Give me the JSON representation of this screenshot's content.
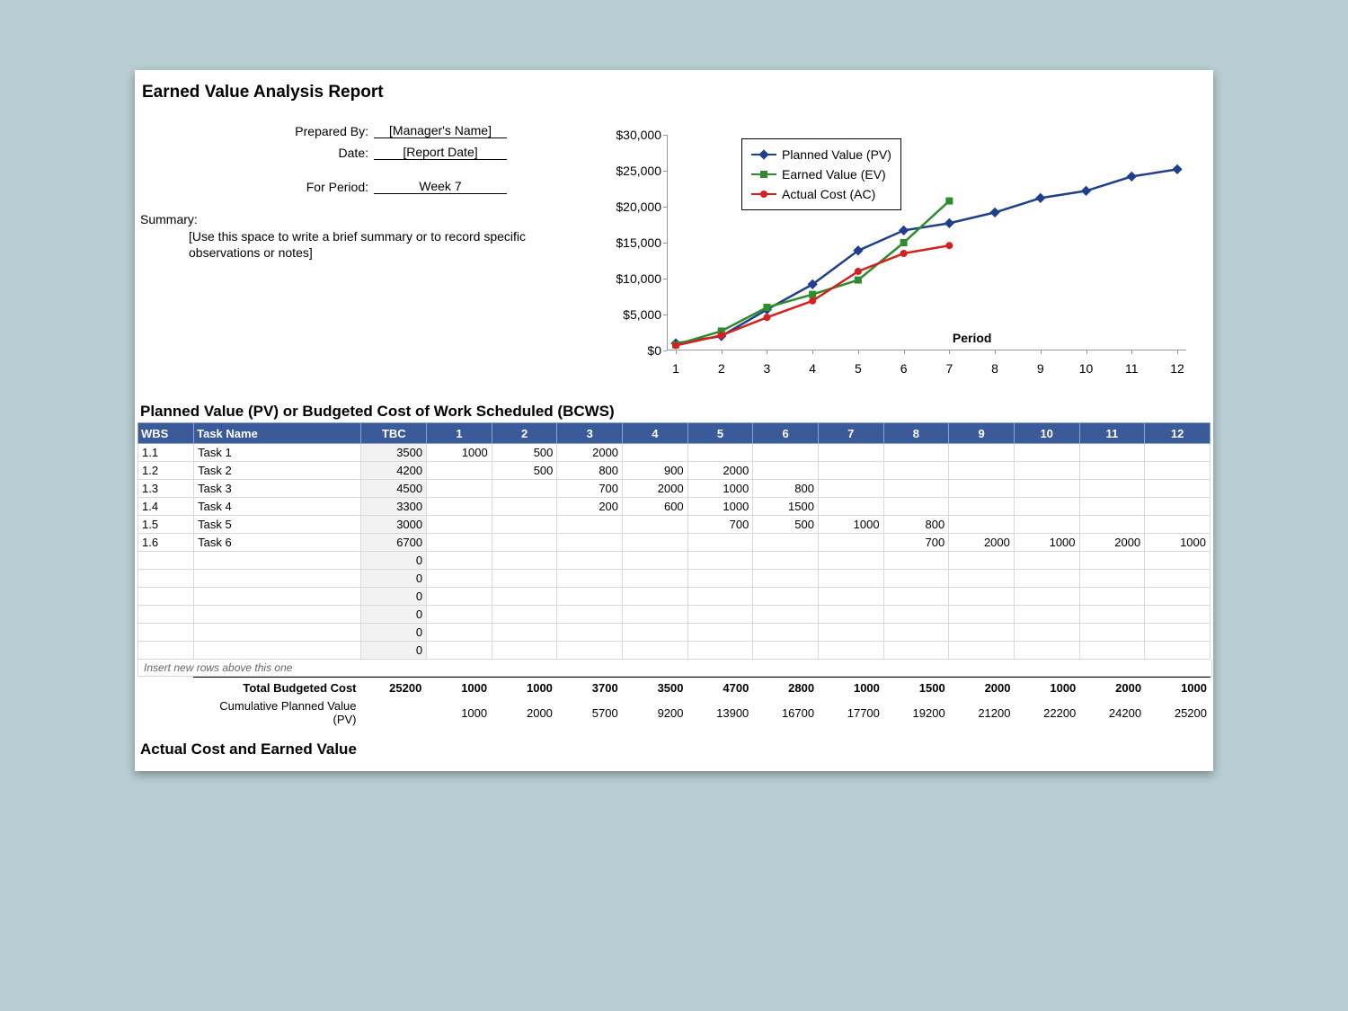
{
  "title": "Earned Value Analysis Report",
  "meta": {
    "prepared_by_label": "Prepared By:",
    "prepared_by_value": "[Manager's Name]",
    "date_label": "Date:",
    "date_value": "[Report Date]",
    "period_label": "For Period:",
    "period_value": "Week 7"
  },
  "summary": {
    "label": "Summary:",
    "text": "[Use this space to write a brief summary or to record specific observations or notes]"
  },
  "chart_data": {
    "type": "line",
    "title": "",
    "xlabel": "Period",
    "ylabel": "",
    "x": [
      1,
      2,
      3,
      4,
      5,
      6,
      7,
      8,
      9,
      10,
      11,
      12
    ],
    "ylim": [
      0,
      30000
    ],
    "yticks": [
      "$0",
      "$5,000",
      "$10,000",
      "$15,000",
      "$20,000",
      "$25,000",
      "$30,000"
    ],
    "series": [
      {
        "name": "Planned Value (PV)",
        "color": "#1f3f8c",
        "marker": "diamond",
        "values": [
          1000,
          2000,
          5700,
          9200,
          13900,
          16700,
          17700,
          19200,
          21200,
          22200,
          24200,
          25200
        ]
      },
      {
        "name": "Earned Value (EV)",
        "color": "#2e8b2e",
        "marker": "square",
        "values": [
          800,
          2700,
          6000,
          7800,
          9800,
          15000,
          20800,
          null,
          null,
          null,
          null,
          null
        ]
      },
      {
        "name": "Actual Cost (AC)",
        "color": "#d62020",
        "marker": "circle",
        "values": [
          700,
          2100,
          4600,
          6900,
          11000,
          13500,
          14600,
          null,
          null,
          null,
          null,
          null
        ]
      }
    ]
  },
  "pv_table": {
    "section_title": "Planned Value (PV) or Budgeted Cost of Work Scheduled (BCWS)",
    "columns": [
      "WBS",
      "Task Name",
      "TBC",
      "1",
      "2",
      "3",
      "4",
      "5",
      "6",
      "7",
      "8",
      "9",
      "10",
      "11",
      "12"
    ],
    "rows": [
      {
        "wbs": "1.1",
        "task": "Task 1",
        "tbc": "3500",
        "p": [
          "1000",
          "500",
          "2000",
          "",
          "",
          "",
          "",
          "",
          "",
          "",
          "",
          ""
        ]
      },
      {
        "wbs": "1.2",
        "task": "Task 2",
        "tbc": "4200",
        "p": [
          "",
          "500",
          "800",
          "900",
          "2000",
          "",
          "",
          "",
          "",
          "",
          "",
          ""
        ]
      },
      {
        "wbs": "1.3",
        "task": "Task 3",
        "tbc": "4500",
        "p": [
          "",
          "",
          "700",
          "2000",
          "1000",
          "800",
          "",
          "",
          "",
          "",
          "",
          ""
        ]
      },
      {
        "wbs": "1.4",
        "task": "Task 4",
        "tbc": "3300",
        "p": [
          "",
          "",
          "200",
          "600",
          "1000",
          "1500",
          "",
          "",
          "",
          "",
          "",
          ""
        ]
      },
      {
        "wbs": "1.5",
        "task": "Task 5",
        "tbc": "3000",
        "p": [
          "",
          "",
          "",
          "",
          "700",
          "500",
          "1000",
          "800",
          "",
          "",
          "",
          ""
        ]
      },
      {
        "wbs": "1.6",
        "task": "Task 6",
        "tbc": "6700",
        "p": [
          "",
          "",
          "",
          "",
          "",
          "",
          "",
          "700",
          "2000",
          "1000",
          "2000",
          "1000"
        ]
      },
      {
        "wbs": "",
        "task": "",
        "tbc": "0",
        "p": [
          "",
          "",
          "",
          "",
          "",
          "",
          "",
          "",
          "",
          "",
          "",
          ""
        ]
      },
      {
        "wbs": "",
        "task": "",
        "tbc": "0",
        "p": [
          "",
          "",
          "",
          "",
          "",
          "",
          "",
          "",
          "",
          "",
          "",
          ""
        ]
      },
      {
        "wbs": "",
        "task": "",
        "tbc": "0",
        "p": [
          "",
          "",
          "",
          "",
          "",
          "",
          "",
          "",
          "",
          "",
          "",
          ""
        ]
      },
      {
        "wbs": "",
        "task": "",
        "tbc": "0",
        "p": [
          "",
          "",
          "",
          "",
          "",
          "",
          "",
          "",
          "",
          "",
          "",
          ""
        ]
      },
      {
        "wbs": "",
        "task": "",
        "tbc": "0",
        "p": [
          "",
          "",
          "",
          "",
          "",
          "",
          "",
          "",
          "",
          "",
          "",
          ""
        ]
      },
      {
        "wbs": "",
        "task": "",
        "tbc": "0",
        "p": [
          "",
          "",
          "",
          "",
          "",
          "",
          "",
          "",
          "",
          "",
          "",
          ""
        ]
      }
    ],
    "insert_note": "Insert new rows above this one",
    "total_row": {
      "label": "Total Budgeted Cost",
      "tbc": "25200",
      "p": [
        "1000",
        "1000",
        "3700",
        "3500",
        "4700",
        "2800",
        "1000",
        "1500",
        "2000",
        "1000",
        "2000",
        "1000"
      ]
    },
    "cum_row": {
      "label": "Cumulative Planned Value (PV)",
      "tbc": "",
      "p": [
        "1000",
        "2000",
        "5700",
        "9200",
        "13900",
        "16700",
        "17700",
        "19200",
        "21200",
        "22200",
        "24200",
        "25200"
      ]
    }
  },
  "next_section_title": "Actual Cost and Earned Value"
}
